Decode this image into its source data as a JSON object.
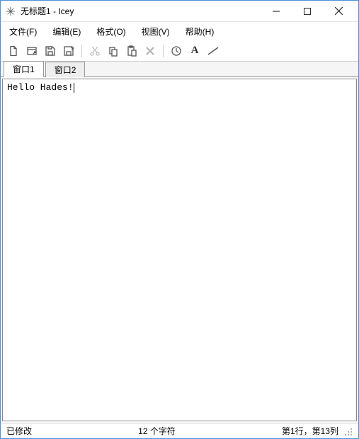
{
  "titlebar": {
    "title": "无标题1 - Icey",
    "app_icon": "snowflake-icon"
  },
  "window_controls": {
    "minimize": "minimize",
    "maximize": "maximize",
    "close": "close"
  },
  "menubar": {
    "items": [
      {
        "label": "文件(F)"
      },
      {
        "label": "编辑(E)"
      },
      {
        "label": "格式(O)"
      },
      {
        "label": "视图(V)"
      },
      {
        "label": "帮助(H)"
      }
    ]
  },
  "toolbar": {
    "icons": {
      "new": "new-file",
      "new_window": "new-window",
      "save": "save",
      "save_as": "save-as",
      "cut": "cut",
      "copy": "copy",
      "paste": "paste",
      "delete": "delete",
      "history": "history",
      "font": "font",
      "edit_line": "edit-line"
    }
  },
  "tabs": [
    {
      "label": "窗口1",
      "active": true
    },
    {
      "label": "窗口2",
      "active": false
    }
  ],
  "editor": {
    "content": "Hello Hades!"
  },
  "statusbar": {
    "modified": "已修改",
    "char_count": "12 个字符",
    "position": "第1行，第13列"
  }
}
